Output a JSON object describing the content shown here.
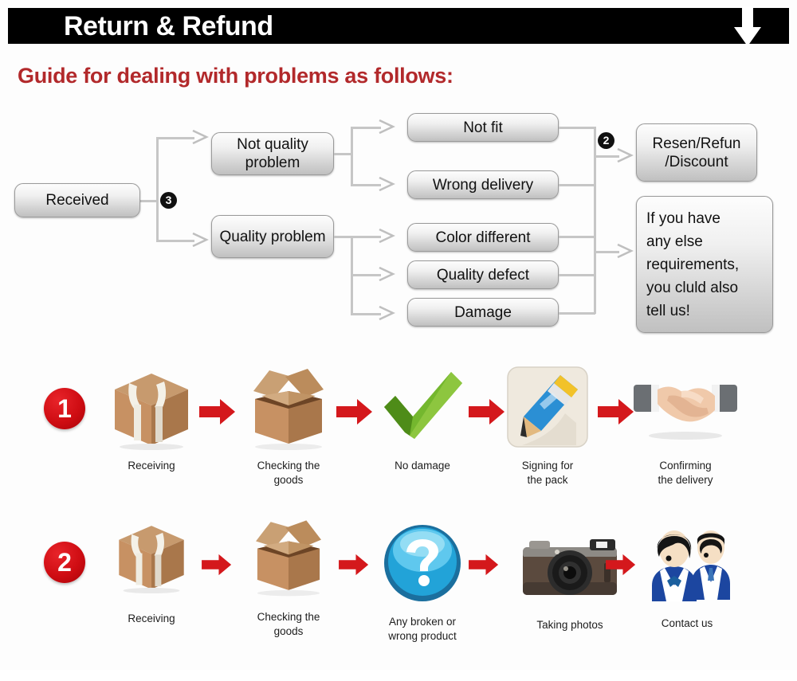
{
  "header": {
    "title": "Return & Refund",
    "arrow_icon": "down-arrow-icon",
    "bar_color": "#000000",
    "title_color": "#ffffff"
  },
  "guide": {
    "heading": "Guide for dealing with problems as follows:",
    "heading_color": "#b2292b"
  },
  "flowchart": {
    "start": {
      "label": "Received"
    },
    "badge_three": "3",
    "badge_two": "2",
    "branches": [
      {
        "label": "Not quality problem"
      },
      {
        "label": "Quality problem"
      }
    ],
    "reasons": [
      {
        "label": "Not fit"
      },
      {
        "label": "Wrong delivery"
      },
      {
        "label": "Color different"
      },
      {
        "label": "Quality defect"
      },
      {
        "label": "Damage"
      }
    ],
    "outcomes": [
      {
        "label": "Resen/Refun /Discount",
        "line1": "Resen/Refun",
        "line2": "/Discount"
      },
      {
        "label": "If you have any else requirements, you cluld also tell us!",
        "lines": [
          "If you have",
          "any else",
          "requirements,",
          "you cluld also",
          "tell us!"
        ]
      }
    ]
  },
  "process_rows": [
    {
      "badge": "1",
      "steps": [
        {
          "icon": "closed-box-icon",
          "caption": "Receiving"
        },
        {
          "icon": "open-box-icon",
          "caption": "Checking the goods",
          "line1": "Checking the",
          "line2": "goods"
        },
        {
          "icon": "green-check-icon",
          "caption": "No damage"
        },
        {
          "icon": "pencil-signing-icon",
          "caption": "Signing for the pack",
          "line1": "Signing for",
          "line2": "the pack"
        },
        {
          "icon": "handshake-icon",
          "caption": "Confirming the delivery",
          "line1": "Confirming",
          "line2": "the delivery"
        }
      ]
    },
    {
      "badge": "2",
      "steps": [
        {
          "icon": "closed-box-icon",
          "caption": "Receiving"
        },
        {
          "icon": "open-box-icon",
          "caption": "Checking the goods",
          "line1": "Checking the",
          "line2": "goods"
        },
        {
          "icon": "question-mark-icon",
          "caption": "Any broken or wrong product",
          "line1": "Any broken or",
          "line2": "wrong product"
        },
        {
          "icon": "camera-icon",
          "caption": "Taking photos"
        },
        {
          "icon": "support-people-icon",
          "caption": "Contact us"
        }
      ]
    }
  ],
  "colors": {
    "red_arrow": "#d4181c",
    "badge_red": "#cf0d13",
    "box_border": "#9a9a9a",
    "connector": "#c6c6c6"
  }
}
